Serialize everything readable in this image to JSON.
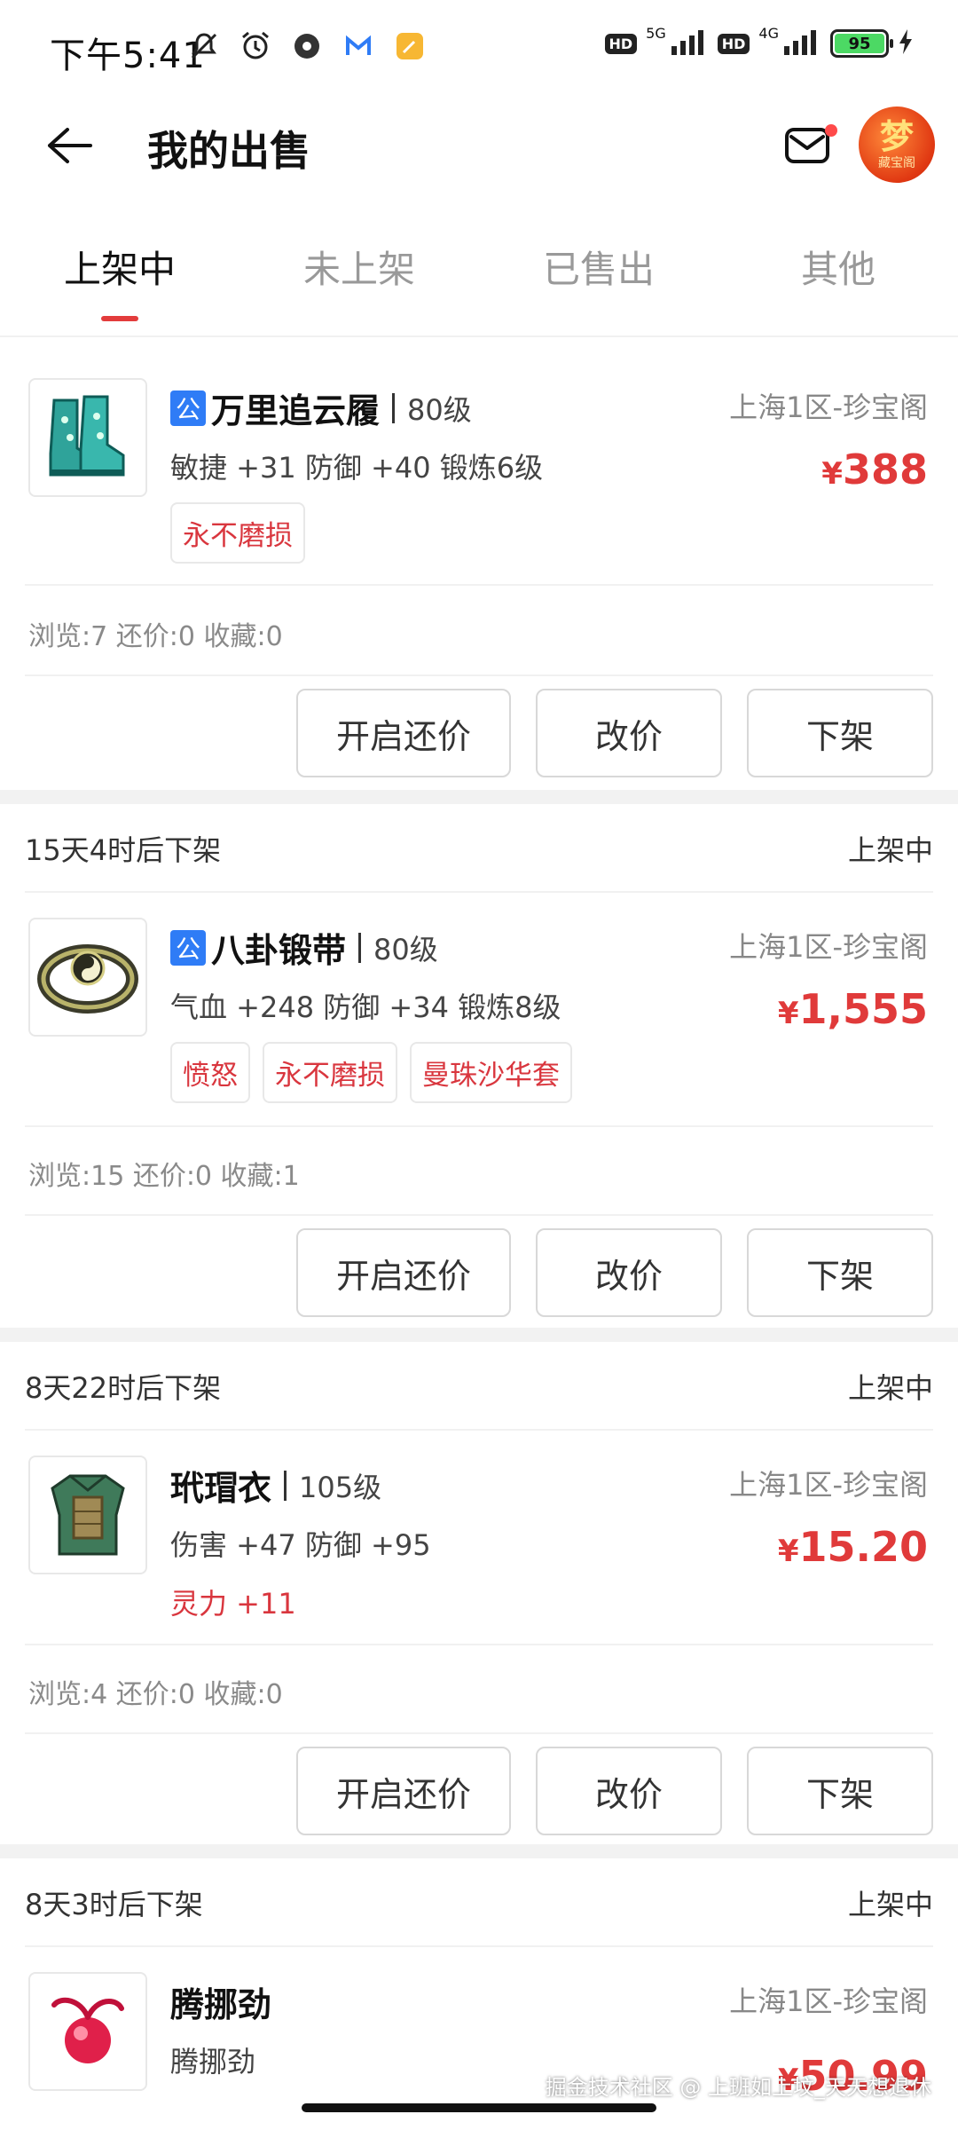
{
  "status_bar": {
    "time": "下午5:41",
    "net1": "5G",
    "net2": "4G",
    "hd": "HD",
    "battery": "95",
    "icons": [
      "mute-icon",
      "alarm-icon",
      "app-dot-icon",
      "mail-app-icon",
      "notes-app-icon",
      "signal-icon",
      "charging-icon"
    ]
  },
  "header": {
    "title": "我的出售",
    "avatar_main": "梦",
    "avatar_sub": "藏宝阁"
  },
  "tabs": [
    {
      "label": "上架中",
      "active": true
    },
    {
      "label": "未上架",
      "active": false
    },
    {
      "label": "已售出",
      "active": false
    },
    {
      "label": "其他",
      "active": false
    }
  ],
  "items": [
    {
      "countdown": "",
      "status": "",
      "public": true,
      "name": "万里追云履",
      "level": "80级",
      "server": "上海1区-珍宝阁",
      "attrs": "敏捷 +31 防御 +40 锻炼6级",
      "price_symbol": "¥",
      "price": "388",
      "tags": [
        "永不磨损"
      ],
      "extra": "",
      "stats": "浏览:7 还价:0 收藏:0",
      "image": "boots-icon"
    },
    {
      "countdown": "15天4时后下架",
      "status": "上架中",
      "public": true,
      "name": "八卦锻带",
      "level": "80级",
      "server": "上海1区-珍宝阁",
      "attrs": "气血 +248 防御 +34 锻炼8级",
      "price_symbol": "¥",
      "price": "1,555",
      "tags": [
        "愤怒",
        "永不磨损",
        "曼珠沙华套"
      ],
      "extra": "",
      "stats": "浏览:15 还价:0 收藏:1",
      "image": "belt-icon"
    },
    {
      "countdown": "8天22时后下架",
      "status": "上架中",
      "public": false,
      "name": "玳瑁衣",
      "level": "105级",
      "server": "上海1区-珍宝阁",
      "attrs": "伤害 +47 防御 +95",
      "price_symbol": "¥",
      "price": "15.20",
      "tags": [],
      "extra": "灵力 +11",
      "stats": "浏览:4 还价:0 收藏:0",
      "image": "armor-icon"
    },
    {
      "countdown": "8天3时后下架",
      "status": "上架中",
      "public": false,
      "name": "腾挪劲",
      "level": "",
      "server": "上海1区-珍宝阁",
      "attrs": "腾挪劲",
      "price_symbol": "¥",
      "price": "50.99",
      "tags": [],
      "extra": "",
      "stats": "",
      "image": "orb-icon"
    }
  ],
  "actions": {
    "counter_offer": "开启还价",
    "edit_price": "改价",
    "delist": "下架",
    "public_badge": "公"
  },
  "watermark": "掘金技术社区 @ 上班如上坟_天天想退休",
  "colors": {
    "accent": "#e33c3c",
    "price": "#e03a3a",
    "badge": "#2f7cf6"
  }
}
